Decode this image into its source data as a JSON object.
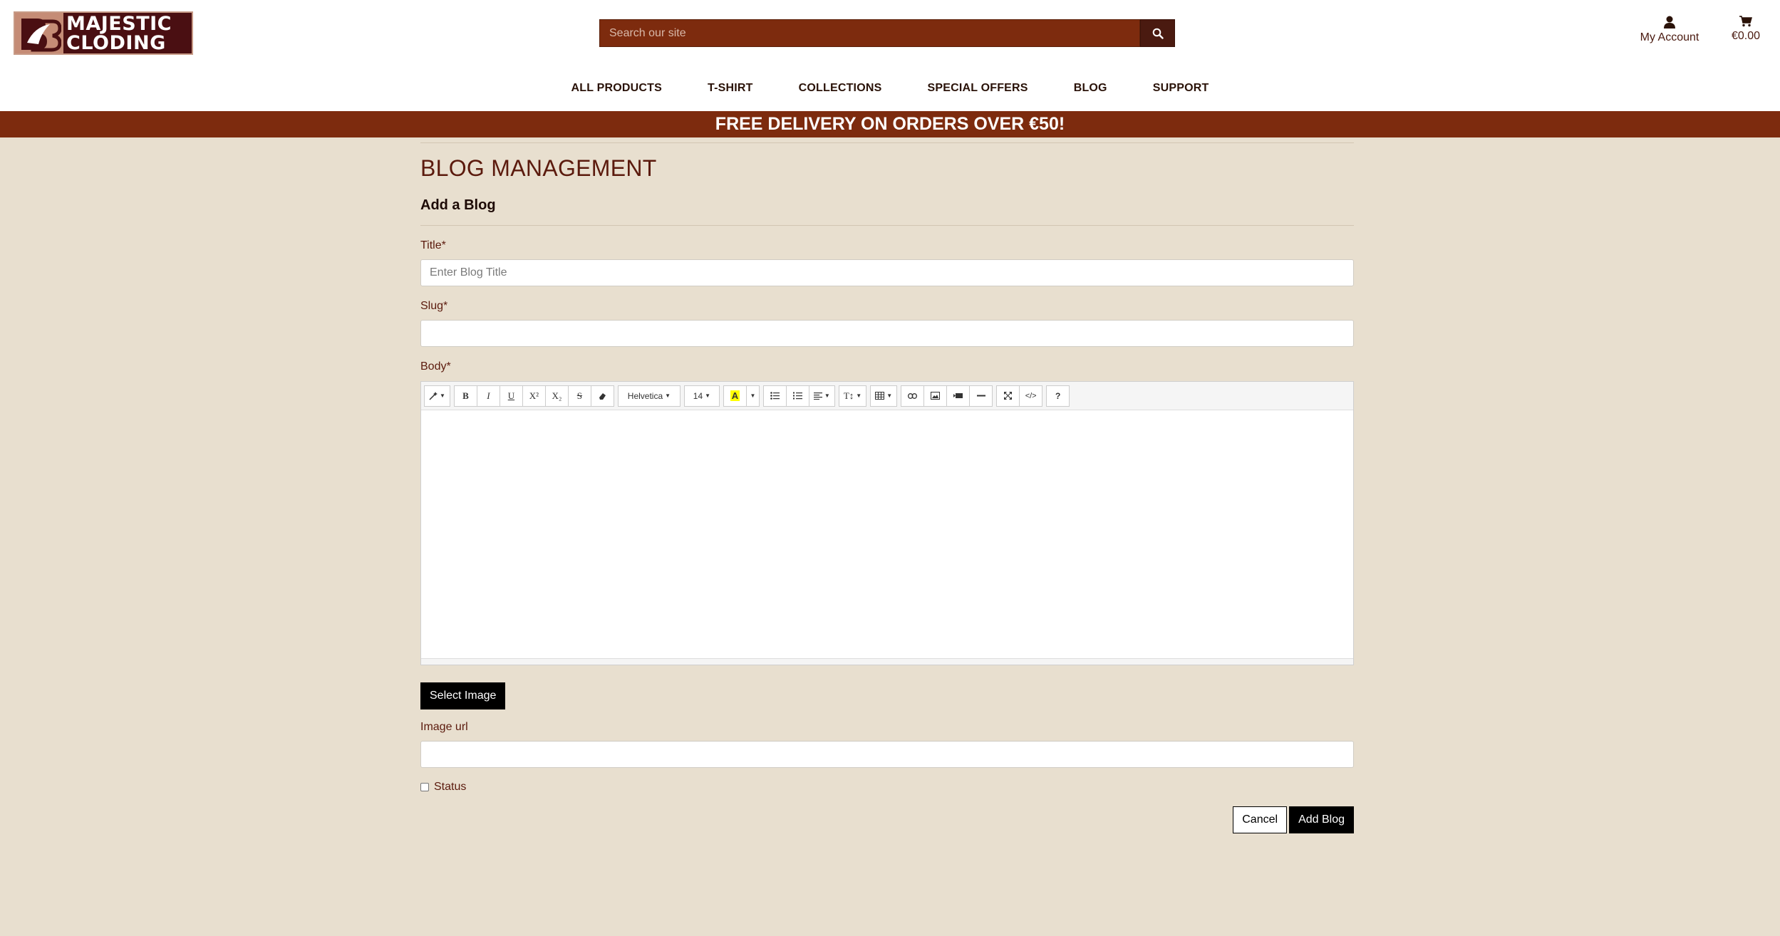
{
  "brand": {
    "name_line1": "MAJESTIC",
    "name_line2": "CLODING",
    "color_primary": "#7d2b0e",
    "color_dark": "#4a0f12",
    "color_background": "#e8dfcf"
  },
  "search": {
    "placeholder": "Search our site",
    "icon": "search-icon"
  },
  "account": {
    "label": "My Account",
    "icon": "user-icon"
  },
  "cart": {
    "total": "€0.00",
    "icon": "cart-icon"
  },
  "nav": {
    "items": [
      {
        "label": "ALL PRODUCTS"
      },
      {
        "label": "T-SHIRT"
      },
      {
        "label": "COLLECTIONS"
      },
      {
        "label": "SPECIAL OFFERS"
      },
      {
        "label": "BLOG"
      },
      {
        "label": "SUPPORT"
      }
    ]
  },
  "banner": {
    "text": "FREE DELIVERY ON ORDERS OVER €50!"
  },
  "page": {
    "title": "BLOG MANAGEMENT",
    "section_title": "Add a Blog"
  },
  "form": {
    "title_label": "Title*",
    "title_placeholder": "Enter Blog Title",
    "title_value": "",
    "slug_label": "Slug*",
    "slug_value": "",
    "body_label": "Body*",
    "image_url_label": "Image url",
    "image_url_value": "",
    "status_label": "Status",
    "status_checked": false,
    "select_image_label": "Select Image",
    "cancel_label": "Cancel",
    "submit_label": "Add Blog"
  },
  "editor": {
    "font_family": "Helvetica",
    "font_size": "14",
    "toolbar": [
      {
        "group": "style",
        "buttons": [
          "magic-icon"
        ]
      },
      {
        "group": "font",
        "buttons": [
          "B",
          "I",
          "U",
          "X²",
          "X₂",
          "S",
          "eraser-icon"
        ]
      },
      {
        "group": "fontname",
        "value": "Helvetica"
      },
      {
        "group": "fontsize",
        "value": "14"
      },
      {
        "group": "color",
        "buttons": [
          "text-color-icon"
        ]
      },
      {
        "group": "para",
        "buttons": [
          "unordered-list-icon",
          "ordered-list-icon",
          "align-icon"
        ]
      },
      {
        "group": "height",
        "buttons": [
          "line-height-icon"
        ]
      },
      {
        "group": "table",
        "buttons": [
          "table-icon"
        ]
      },
      {
        "group": "insert",
        "buttons": [
          "link-icon",
          "image-icon",
          "video-icon",
          "hr-icon"
        ]
      },
      {
        "group": "view",
        "buttons": [
          "fullscreen-icon",
          "codeview-icon"
        ]
      },
      {
        "group": "help",
        "buttons": [
          "?"
        ]
      }
    ]
  }
}
